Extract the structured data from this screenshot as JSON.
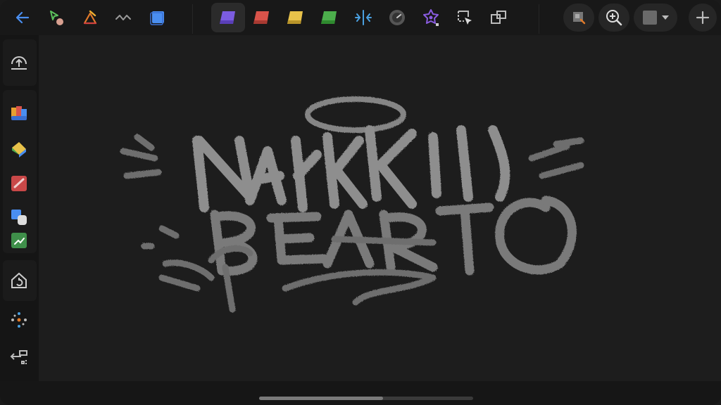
{
  "toolbar": {
    "left_tools": [
      {
        "icon": "back-arrow-icon"
      },
      {
        "icon": "select-lasso-icon"
      },
      {
        "icon": "transform-icon"
      },
      {
        "icon": "stroke-wave-icon"
      },
      {
        "icon": "layer-square-icon"
      }
    ],
    "center_tools": [
      {
        "icon": "purple-eraser-icon",
        "color": "#7b5ce0",
        "active": true
      },
      {
        "icon": "red-eraser-icon",
        "color": "#d9534a"
      },
      {
        "icon": "yellow-eraser-icon",
        "color": "#e8c24a"
      },
      {
        "icon": "green-eraser-icon",
        "color": "#4cae4c"
      },
      {
        "icon": "symmetry-icon"
      },
      {
        "icon": "dial-icon"
      },
      {
        "icon": "star-shape-icon"
      },
      {
        "icon": "crop-cursor-icon"
      },
      {
        "icon": "frames-icon"
      }
    ],
    "right_tools": [
      {
        "icon": "reference-image-icon"
      },
      {
        "icon": "zoom-in-icon"
      },
      {
        "icon": "color-swatch-dropdown-icon",
        "color": "#6a6a6a"
      },
      {
        "icon": "add-icon"
      }
    ]
  },
  "sidebar": {
    "items": [
      {
        "icon": "upload-icon"
      },
      {
        "icon": "color-cube-icon"
      },
      {
        "icon": "fill-bucket-icon"
      },
      {
        "icon": "brush-stroke-icon"
      },
      {
        "icon": "shape-stack-icon"
      },
      {
        "icon": "green-chart-icon"
      },
      {
        "icon": "home-rotate-icon"
      },
      {
        "icon": "sparkle-dots-icon"
      },
      {
        "icon": "layer-move-icon"
      }
    ]
  },
  "canvas": {
    "artwork": "graffiti-tag-drawing",
    "background": "#1d1d1d",
    "stroke_color": "#8a8a8a"
  },
  "bottom": {
    "scroll_progress": 0.58
  }
}
